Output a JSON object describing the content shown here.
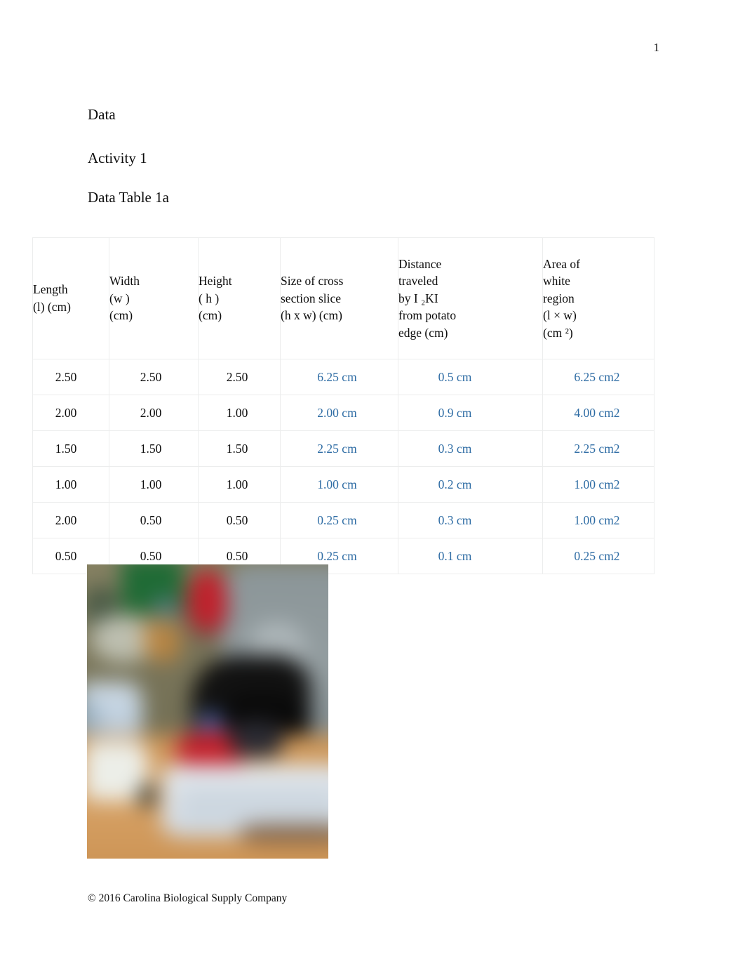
{
  "document": {
    "page_number": "1",
    "headings": {
      "section": "Data",
      "activity": "Activity 1",
      "table_caption": "Data Table 1a"
    },
    "footer": "© 2016 Carolina Biological Supply Company"
  },
  "colors": {
    "entered_value_blue": "#2e6ca4",
    "text_black": "#0d0d0d",
    "table_border": "#eceded"
  },
  "table": {
    "headers": [
      {
        "lines": [
          "Length",
          "(l) (cm)"
        ]
      },
      {
        "lines": [
          "Width",
          "(w )",
          "(cm)"
        ]
      },
      {
        "lines": [
          "Height",
          "( h )",
          "(cm)"
        ]
      },
      {
        "lines": [
          "Size of cross",
          "section slice",
          "(h x w) (cm)"
        ]
      },
      {
        "lines": [
          "Distance",
          "traveled",
          "by I ₂KI",
          "from potato",
          "edge (cm)"
        ]
      },
      {
        "lines": [
          "Area of",
          "white",
          "region",
          "(l × w)",
          "(cm ²)"
        ]
      }
    ],
    "header_plain": [
      "Length (l) (cm)",
      "Width (w ) (cm)",
      "Height ( h ) (cm)",
      "Size of cross section slice (h x w) (cm)",
      "Distance traveled by I2KI from potato edge (cm)",
      "Area of white region (l × w) (cm2)"
    ],
    "rows": [
      {
        "length": "2.50",
        "width": "2.50",
        "height": "2.50",
        "cross_section": "6.25 cm",
        "distance": "0.5 cm",
        "area": "6.25 cm2"
      },
      {
        "length": "2.00",
        "width": "2.00",
        "height": "1.00",
        "cross_section": "2.00 cm",
        "distance": "0.9 cm",
        "area": "4.00 cm2"
      },
      {
        "length": "1.50",
        "width": "1.50",
        "height": "1.50",
        "cross_section": "2.25 cm",
        "distance": "0.3 cm",
        "area": "2.25 cm2"
      },
      {
        "length": "1.00",
        "width": "1.00",
        "height": "1.00",
        "cross_section": "1.00 cm",
        "distance": "0.2 cm",
        "area": "1.00 cm2"
      },
      {
        "length": "2.00",
        "width": "0.50",
        "height": "0.50",
        "cross_section": "0.25 cm",
        "distance": "0.3 cm",
        "area": "1.00 cm2"
      },
      {
        "length": "0.50",
        "width": "0.50",
        "height": "0.50",
        "cross_section": "0.25 cm",
        "distance": "0.1 cm",
        "area": "0.25 cm2"
      }
    ]
  },
  "photo": {
    "alt": "blurred photograph of a lab bench with potato experiment materials"
  }
}
